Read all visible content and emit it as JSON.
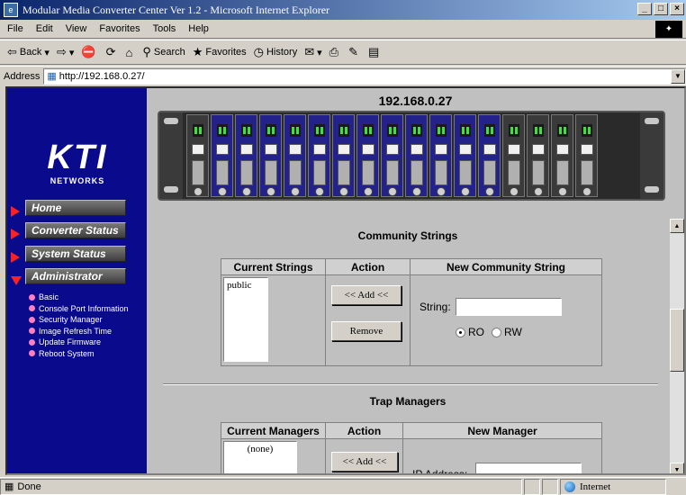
{
  "window": {
    "title": "Modular Media Converter Center Ver 1.2 - Microsoft Internet Explorer",
    "min_label": "_",
    "max_label": "×"
  },
  "menu": [
    "File",
    "Edit",
    "View",
    "Favorites",
    "Tools",
    "Help"
  ],
  "toolbar": {
    "back_label": "Back",
    "search_label": "Search",
    "favorites_label": "Favorites",
    "history_label": "History"
  },
  "address": {
    "label": "Address",
    "url": "http://192.168.0.27/"
  },
  "logo": {
    "main": "KTI",
    "sub": "NETWORKS"
  },
  "nav": {
    "items": [
      {
        "label": "Home"
      },
      {
        "label": "Converter Status"
      },
      {
        "label": "System Status"
      },
      {
        "label": "Administrator"
      }
    ],
    "sub_items": [
      "Basic",
      "Console Port Information",
      "Security Manager",
      "Image Refresh Time",
      "Update Firmware",
      "Reboot System"
    ]
  },
  "device": {
    "ip": "192.168.0.27"
  },
  "community": {
    "title": "Community Strings",
    "col_current": "Current Strings",
    "col_action": "Action",
    "col_new": "New Community String",
    "current_values": [
      "public"
    ],
    "add_label": "<< Add <<",
    "remove_label": "Remove",
    "string_label": "String:",
    "string_value": "",
    "ro_label": "RO",
    "rw_label": "RW",
    "selected": "RO"
  },
  "trap": {
    "title": "Trap Managers",
    "col_current": "Current Managers",
    "col_action": "Action",
    "col_new": "New Manager",
    "current_values": [
      "(none)"
    ],
    "add_label": "<< Add <<",
    "ip_label": "IP Address:"
  },
  "status": {
    "text": "Done",
    "zone": "Internet"
  },
  "colors": {
    "sidebar": "#0a0a8c",
    "arrow": "#ff2020",
    "sub_dot": "#ff7fbf",
    "panel": "#c0c0c0"
  }
}
